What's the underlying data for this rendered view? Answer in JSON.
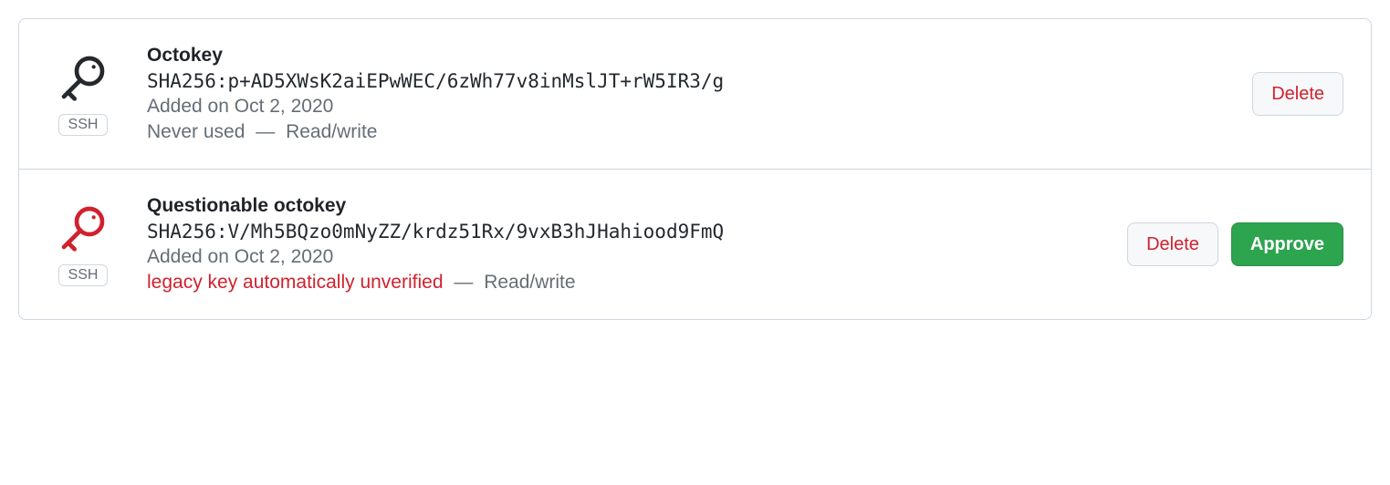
{
  "badge_label": "SSH",
  "status_separator": "—",
  "keys": [
    {
      "title": "Octokey",
      "fingerprint": "SHA256:p+AD5XWsK2aiEPwWEC/6zWh77v8inMslJT+rW5IR3/g",
      "added": "Added on Oct 2, 2020",
      "usage": "Never used",
      "usage_warning": false,
      "access": "Read/write",
      "icon_color": "#24292e",
      "actions": {
        "delete": "Delete"
      }
    },
    {
      "title": "Questionable octokey",
      "fingerprint": "SHA256:V/Mh5BQzo0mNyZZ/krdz51Rx/9vxB3hJHahiood9FmQ",
      "added": "Added on Oct 2, 2020",
      "usage": "legacy key automatically unverified",
      "usage_warning": true,
      "access": "Read/write",
      "icon_color": "#cf222e",
      "actions": {
        "delete": "Delete",
        "approve": "Approve"
      }
    }
  ]
}
